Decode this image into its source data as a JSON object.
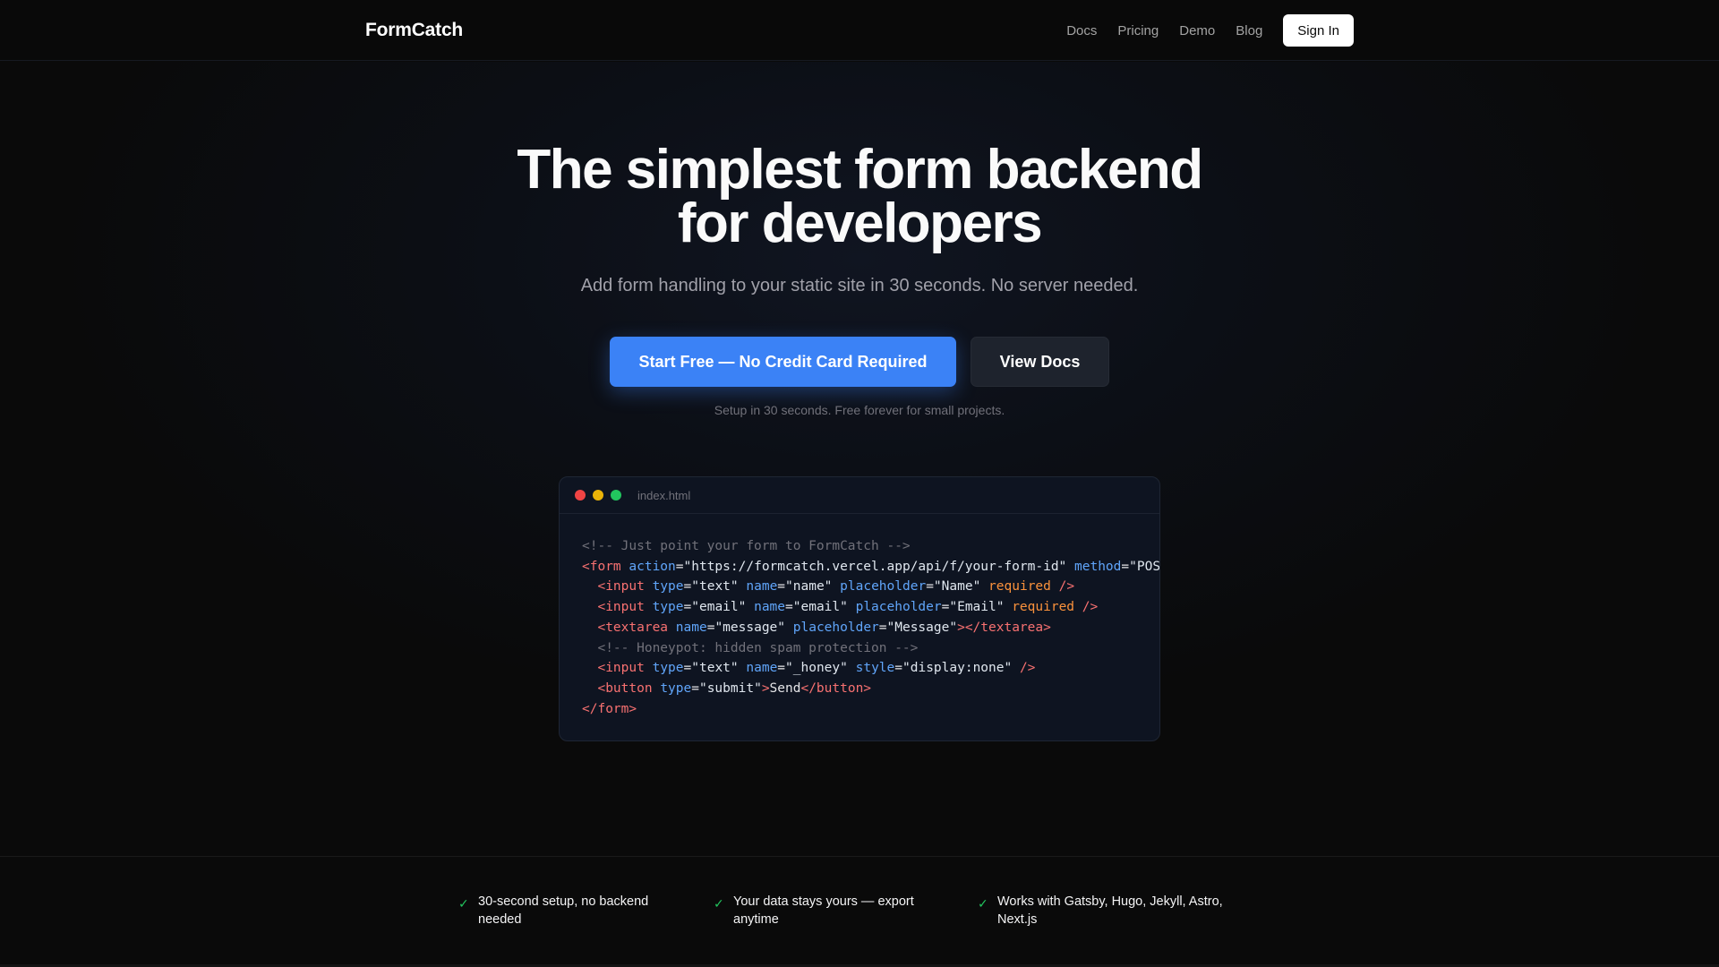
{
  "brand": {
    "name": "FormCatch"
  },
  "nav": {
    "links": [
      "Docs",
      "Pricing",
      "Demo",
      "Blog"
    ],
    "signin_label": "Sign In"
  },
  "hero": {
    "title_line1": "The simplest form backend",
    "title_line2": "for developers",
    "subtitle": "Add form handling to your static site in 30 seconds. No server needed.",
    "primary_cta": "Start Free — No Credit Card Required",
    "secondary_cta": "View Docs",
    "note": "Setup in 30 seconds. Free forever for small projects."
  },
  "code_window": {
    "filename": "index.html",
    "lines": [
      [
        {
          "t": "c",
          "v": "<!-- Just point your form to FormCatch -->"
        }
      ],
      [
        {
          "t": "g",
          "v": "<form"
        },
        {
          "t": "p",
          "v": " "
        },
        {
          "t": "a",
          "v": "action"
        },
        {
          "t": "p",
          "v": "="
        },
        {
          "t": "s",
          "v": "\"https://formcatch.vercel.app/api/f/your-form-id\""
        },
        {
          "t": "p",
          "v": " "
        },
        {
          "t": "a",
          "v": "method"
        },
        {
          "t": "p",
          "v": "="
        },
        {
          "t": "s",
          "v": "\"POST\""
        },
        {
          "t": "g",
          "v": ">"
        }
      ],
      [
        {
          "t": "p",
          "v": "  "
        },
        {
          "t": "g",
          "v": "<input"
        },
        {
          "t": "p",
          "v": " "
        },
        {
          "t": "a",
          "v": "type"
        },
        {
          "t": "p",
          "v": "="
        },
        {
          "t": "s",
          "v": "\"text\""
        },
        {
          "t": "p",
          "v": " "
        },
        {
          "t": "a",
          "v": "name"
        },
        {
          "t": "p",
          "v": "="
        },
        {
          "t": "s",
          "v": "\"name\""
        },
        {
          "t": "p",
          "v": " "
        },
        {
          "t": "a",
          "v": "placeholder"
        },
        {
          "t": "p",
          "v": "="
        },
        {
          "t": "s",
          "v": "\"Name\""
        },
        {
          "t": "p",
          "v": " "
        },
        {
          "t": "k",
          "v": "required"
        },
        {
          "t": "p",
          "v": " "
        },
        {
          "t": "g",
          "v": "/>"
        }
      ],
      [
        {
          "t": "p",
          "v": "  "
        },
        {
          "t": "g",
          "v": "<input"
        },
        {
          "t": "p",
          "v": " "
        },
        {
          "t": "a",
          "v": "type"
        },
        {
          "t": "p",
          "v": "="
        },
        {
          "t": "s",
          "v": "\"email\""
        },
        {
          "t": "p",
          "v": " "
        },
        {
          "t": "a",
          "v": "name"
        },
        {
          "t": "p",
          "v": "="
        },
        {
          "t": "s",
          "v": "\"email\""
        },
        {
          "t": "p",
          "v": " "
        },
        {
          "t": "a",
          "v": "placeholder"
        },
        {
          "t": "p",
          "v": "="
        },
        {
          "t": "s",
          "v": "\"Email\""
        },
        {
          "t": "p",
          "v": " "
        },
        {
          "t": "k",
          "v": "required"
        },
        {
          "t": "p",
          "v": " "
        },
        {
          "t": "g",
          "v": "/>"
        }
      ],
      [
        {
          "t": "p",
          "v": "  "
        },
        {
          "t": "g",
          "v": "<textarea"
        },
        {
          "t": "p",
          "v": " "
        },
        {
          "t": "a",
          "v": "name"
        },
        {
          "t": "p",
          "v": "="
        },
        {
          "t": "s",
          "v": "\"message\""
        },
        {
          "t": "p",
          "v": " "
        },
        {
          "t": "a",
          "v": "placeholder"
        },
        {
          "t": "p",
          "v": "="
        },
        {
          "t": "s",
          "v": "\"Message\""
        },
        {
          "t": "g",
          "v": "></textarea>"
        }
      ],
      [
        {
          "t": "p",
          "v": "  "
        },
        {
          "t": "c",
          "v": "<!-- Honeypot: hidden spam protection -->"
        }
      ],
      [
        {
          "t": "p",
          "v": "  "
        },
        {
          "t": "g",
          "v": "<input"
        },
        {
          "t": "p",
          "v": " "
        },
        {
          "t": "a",
          "v": "type"
        },
        {
          "t": "p",
          "v": "="
        },
        {
          "t": "s",
          "v": "\"text\""
        },
        {
          "t": "p",
          "v": " "
        },
        {
          "t": "a",
          "v": "name"
        },
        {
          "t": "p",
          "v": "="
        },
        {
          "t": "s",
          "v": "\"_honey\""
        },
        {
          "t": "p",
          "v": " "
        },
        {
          "t": "a",
          "v": "style"
        },
        {
          "t": "p",
          "v": "="
        },
        {
          "t": "s",
          "v": "\"display:none\""
        },
        {
          "t": "p",
          "v": " "
        },
        {
          "t": "g",
          "v": "/>"
        }
      ],
      [
        {
          "t": "p",
          "v": "  "
        },
        {
          "t": "g",
          "v": "<button"
        },
        {
          "t": "p",
          "v": " "
        },
        {
          "t": "a",
          "v": "type"
        },
        {
          "t": "p",
          "v": "="
        },
        {
          "t": "s",
          "v": "\"submit\""
        },
        {
          "t": "g",
          "v": ">"
        },
        {
          "t": "p",
          "v": "Send"
        },
        {
          "t": "g",
          "v": "</button>"
        }
      ],
      [
        {
          "t": "g",
          "v": "</form>"
        }
      ]
    ]
  },
  "features": [
    {
      "line1": "30-second setup, no backend",
      "line2": "needed"
    },
    {
      "line1": "Your data stays yours — export",
      "line2": "anytime"
    },
    {
      "line1": "Works with Gatsby, Hugo, Jekyll, Astro,",
      "line2": "Next.js"
    }
  ],
  "icons": {
    "check": "check-icon",
    "window_dots": [
      "red-dot",
      "yellow-dot",
      "green-dot"
    ]
  },
  "colors": {
    "accent": "#3b82f6",
    "check": "#22c55e",
    "background": "#0a0a0a"
  }
}
